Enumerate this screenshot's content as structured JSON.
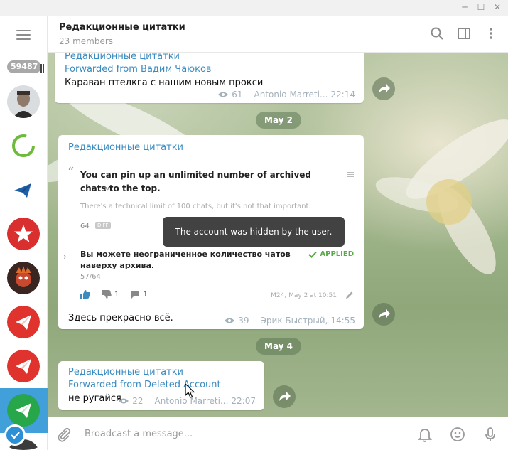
{
  "window": {
    "minimize": "─",
    "maximize": "☐",
    "close": "✕"
  },
  "sidebar": {
    "unread_count": "59487"
  },
  "header": {
    "title": "Редакционные цитатки",
    "subtitle": "23 members"
  },
  "messages": [
    {
      "author": "Редакционные цитатки",
      "forwarded": "Forwarded from Вадим Чаюков",
      "text": "Караван птелкга с нашим новым прокси",
      "views": "61",
      "signature": "Antonio Marreti...",
      "time": "22:14"
    },
    {
      "author": "Редакционные цитатки",
      "quote": "You can pin up an unlimited number of archived chats to the top.",
      "quote_sub": "There's a technical limit of 100 chats, but it's not that important.",
      "quote_count": "64",
      "quote_badge": "DIFF",
      "suggestion": "Вы можете неограниченное количество чатов наверху архива.",
      "suggestion_count": "57/64",
      "applied_label": "APPLIED",
      "dislikes": "1",
      "comments": "1",
      "suggestion_time": "M24, May 2 at 10:51",
      "text": "Здесь прекрасно всё.",
      "views": "39",
      "signature": "Эрик Быстрый,",
      "time": "14:55"
    },
    {
      "author": "Редакционные цитатки",
      "forwarded": "Forwarded from Deleted Account",
      "text": "не ругайся",
      "views": "22",
      "signature": "Antonio Marreti...",
      "time": "22:07"
    }
  ],
  "dates": {
    "first": "May 2",
    "second": "May 4"
  },
  "toast": "The account was hidden by the user.",
  "composer": {
    "placeholder": "Broadcast a message..."
  },
  "colors": {
    "accent": "#419fd9",
    "author": "#3a8bc0",
    "applied": "#5aa84a"
  }
}
